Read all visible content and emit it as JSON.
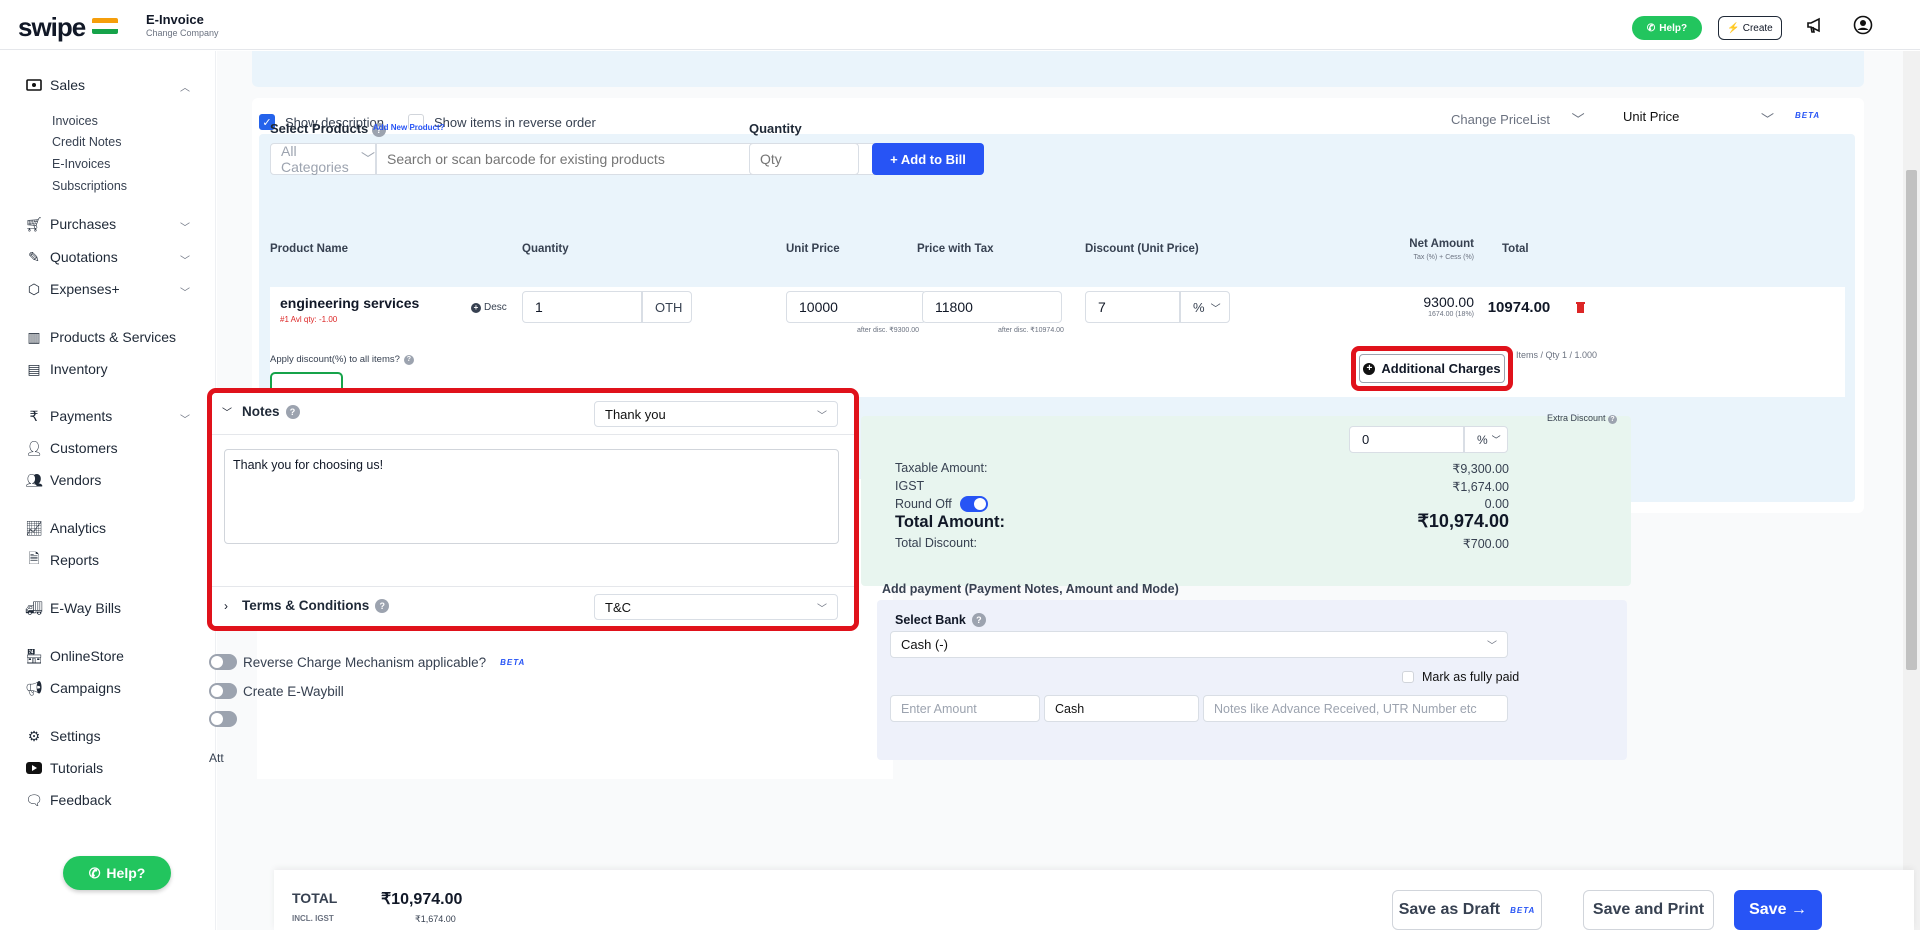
{
  "header": {
    "logo": "swipe",
    "module_title": "E-Invoice",
    "change_company": "Change Company",
    "help_label": "Help?",
    "create_label": "Create"
  },
  "sidebar": {
    "sales": "Sales",
    "sales_sub": [
      "Invoices",
      "Credit Notes",
      "E-Invoices",
      "Subscriptions"
    ],
    "items": [
      {
        "label": "Purchases",
        "icon": "cart-icon"
      },
      {
        "label": "Quotations",
        "icon": "pen-icon"
      },
      {
        "label": "Expenses+",
        "icon": "tag-icon"
      },
      {
        "label": "Products & Services",
        "icon": "barcode-icon"
      },
      {
        "label": "Inventory",
        "icon": "warehouse-icon"
      },
      {
        "label": "Payments",
        "icon": "rupee-icon"
      },
      {
        "label": "Customers",
        "icon": "user-icon"
      },
      {
        "label": "Vendors",
        "icon": "users-icon"
      },
      {
        "label": "Analytics",
        "icon": "chart-icon"
      },
      {
        "label": "Reports",
        "icon": "report-icon"
      },
      {
        "label": "E-Way Bills",
        "icon": "truck-icon"
      },
      {
        "label": "OnlineStore",
        "icon": "store-icon"
      },
      {
        "label": "Campaigns",
        "icon": "megaphone-icon"
      },
      {
        "label": "Settings",
        "icon": "gear-icon"
      },
      {
        "label": "Tutorials",
        "icon": "youtube-icon"
      },
      {
        "label": "Feedback",
        "icon": "chat-icon"
      }
    ],
    "help_label": "Help?"
  },
  "options": {
    "show_description": "Show description",
    "reverse_order": "Show items in reverse order",
    "change_pricelist": "Change PriceList",
    "unit_price": "Unit Price",
    "beta": "BETA"
  },
  "select_products": {
    "label": "Select Products",
    "add_new": "Add New Product?",
    "category": "All Categories",
    "search_placeholder": "Search or scan barcode for existing products",
    "quantity_label": "Quantity",
    "qty_placeholder": "Qty",
    "add_to_bill": "+ Add to Bill"
  },
  "table": {
    "headers": {
      "product_name": "Product Name",
      "quantity": "Quantity",
      "unit_price": "Unit Price",
      "price_with_tax": "Price with Tax",
      "discount": "Discount (Unit Price)",
      "net_amount": "Net Amount",
      "net_amount_sub": "Tax (%) + Cess (%)",
      "total": "Total"
    },
    "row": {
      "name": "engineering services",
      "avl_qty": "#1 Avl qty: -1.00",
      "desc": "Desc",
      "qty": "1",
      "unit": "OTH",
      "unit_price": "10000",
      "unit_price_after": "after disc. ₹9300.00",
      "price_tax": "11800",
      "price_tax_after": "after disc. ₹10974.00",
      "discount": "7",
      "discount_type": "%",
      "net_amount": "9300.00",
      "net_tax": "1674.00 (18%)",
      "total": "10974.00"
    },
    "items_qty": "Items / Qty 1 / 1.000",
    "apply_discount": "Apply discount(%) to all items?",
    "additional_charges": "Additional Charges"
  },
  "notes": {
    "title": "Notes",
    "template": "Thank you",
    "text": "Thank you for choosing us!",
    "terms_title": "Terms & Conditions",
    "terms_template": "T&C"
  },
  "toggles": {
    "reverse_charge": "Reverse Charge Mechanism applicable?",
    "beta": "BETA",
    "ewaybill": "Create E-Waybill",
    "partial": "Att"
  },
  "summary": {
    "extra_discount": "Extra Discount",
    "extra_value": "0",
    "extra_type": "%",
    "taxable_label": "Taxable Amount:",
    "taxable_value": "₹9,300.00",
    "igst_label": "IGST",
    "igst_value": "₹1,674.00",
    "round_off_label": "Round Off",
    "round_off_value": "0.00",
    "total_label": "Total Amount:",
    "total_value": "₹10,974.00",
    "discount_label": "Total Discount:",
    "discount_value": "₹700.00"
  },
  "payment": {
    "title": "Add payment (Payment Notes, Amount and Mode)",
    "select_bank": "Select Bank",
    "bank_value": "Cash (-)",
    "mark_paid": "Mark as fully paid",
    "amount_placeholder": "Enter Amount",
    "mode": "Cash",
    "notes_placeholder": "Notes like Advance Received, UTR Number etc"
  },
  "bottom": {
    "total_label": "TOTAL",
    "total_value": "₹10,974.00",
    "incl_label": "INCL. IGST",
    "incl_value": "₹1,674.00",
    "save_draft": "Save as Draft",
    "beta": "BETA",
    "save_print": "Save and Print",
    "save": "Save →"
  },
  "colors": {
    "accent": "#2754f5",
    "highlight": "#e0121b",
    "help_green": "#22c55e"
  }
}
